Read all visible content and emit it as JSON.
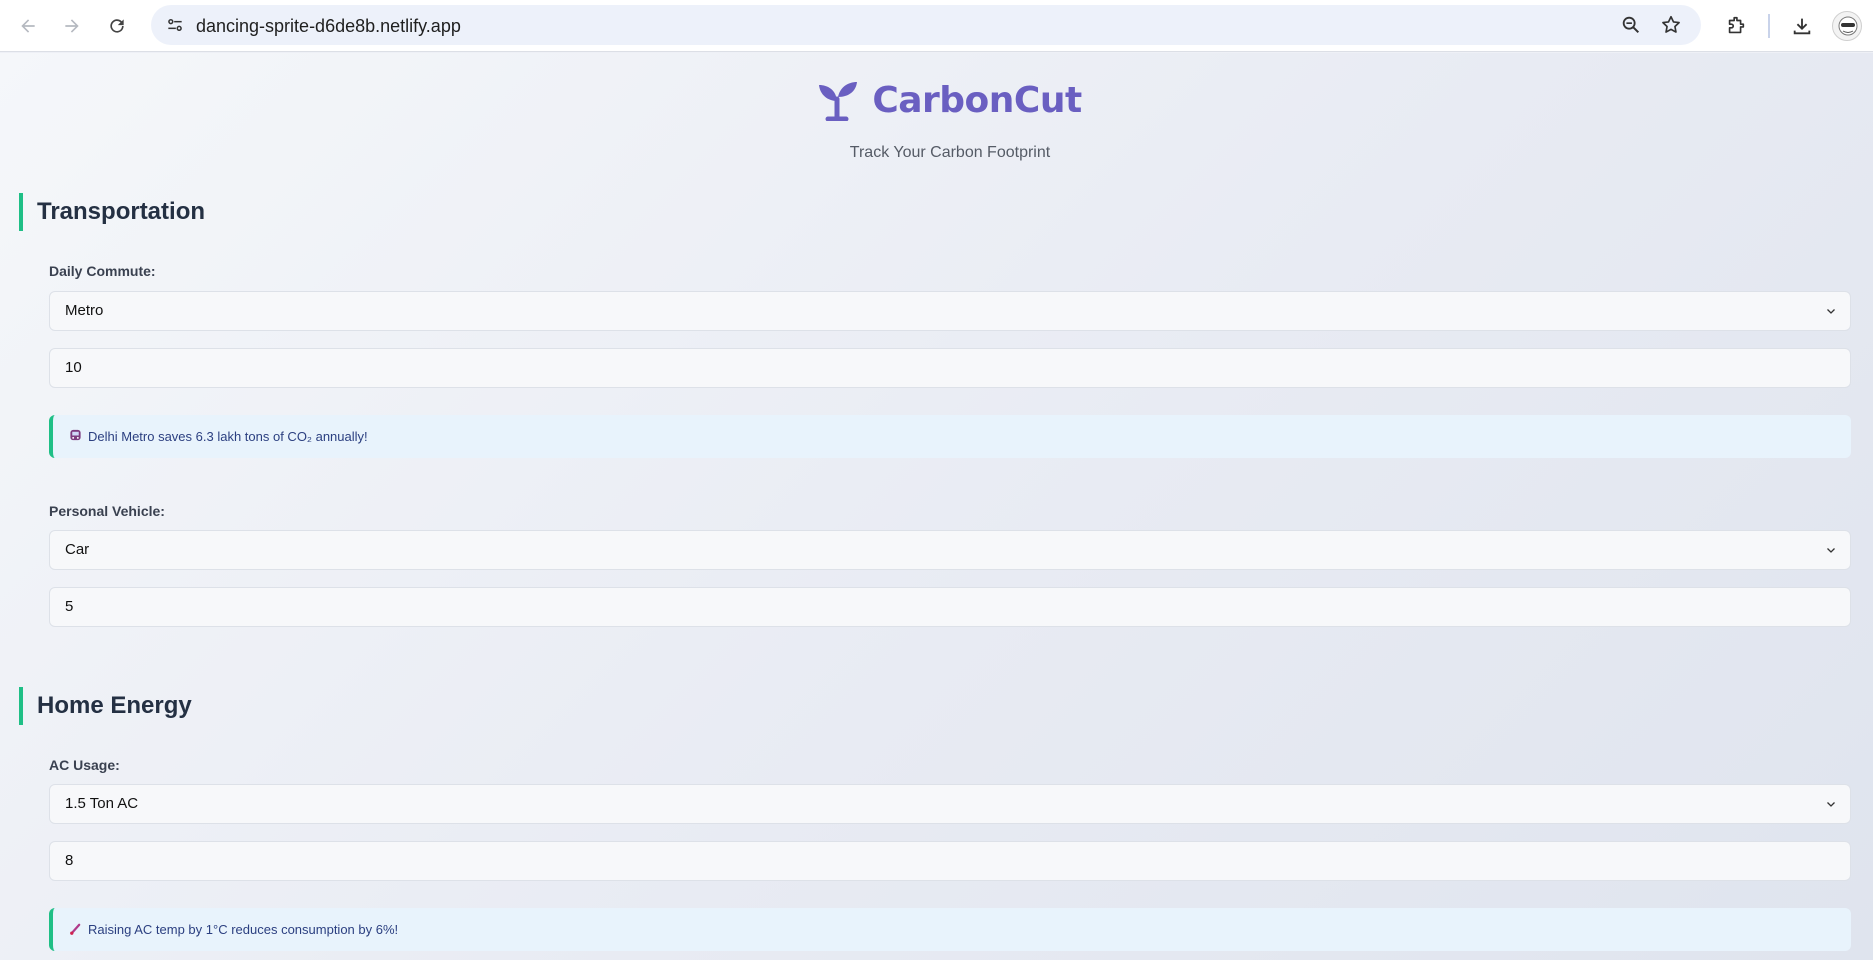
{
  "browser": {
    "url": "dancing-sprite-d6de8b.netlify.app",
    "icons": [
      "back-icon",
      "forward-icon",
      "reload-icon",
      "site-info-icon",
      "zoom-icon",
      "bookmark-star-icon",
      "extensions-icon",
      "download-icon",
      "profile-avatar"
    ]
  },
  "app": {
    "title": "CarbonCut",
    "tagline": "Track Your Carbon Footprint",
    "accent_color": "#6a5fc1",
    "section_accent": "#1fbf86"
  },
  "transportation": {
    "heading": "Transportation",
    "commute": {
      "label": "Daily Commute:",
      "selected": "Metro",
      "value": "10",
      "tip": "Delhi Metro saves 6.3 lakh tons of CO₂ annually!",
      "tip_icon": "metro-emoji"
    },
    "vehicle": {
      "label": "Personal Vehicle:",
      "selected": "Car",
      "value": "5"
    }
  },
  "home_energy": {
    "heading": "Home Energy",
    "ac": {
      "label": "AC Usage:",
      "selected": "1.5 Ton AC",
      "value": "8",
      "tip": "Raising AC temp by 1°C reduces consumption by 6%!",
      "tip_icon": "thermometer-emoji"
    }
  }
}
